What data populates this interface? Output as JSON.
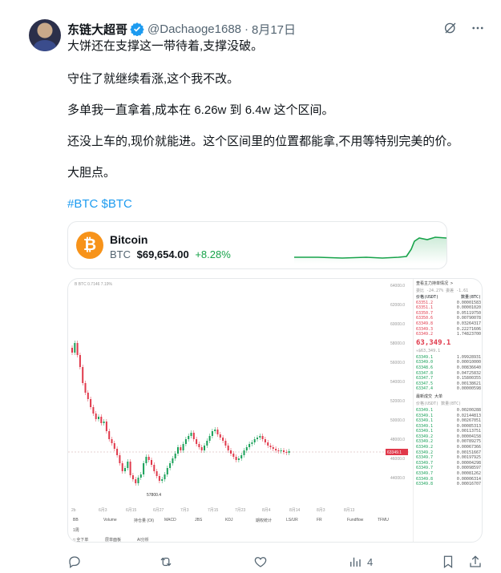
{
  "author": {
    "display_name": "东链大超哥",
    "handle": "@Dachaoge1688",
    "separator": "·",
    "date": "8月17日"
  },
  "body": {
    "p1": "大饼还在支撑这一带待着,支撑没破。",
    "p2": "守住了就继续看涨,这个我不改。",
    "p3": "多单我一直拿着,成本在 6.26w 到 6.4w 这个区间。",
    "p4": "还没上车的,现价就能进。这个区间里的位置都能拿,不用等特别完美的价。",
    "p5": "大胆点。",
    "hashtags": "#BTC $BTC"
  },
  "card": {
    "icon_glyph": "₿",
    "name": "Bitcoin",
    "symbol": "BTC",
    "price": "$69,654.00",
    "change": "+8.28%"
  },
  "chart_image": {
    "ticker_label": "B BTC 0.7146   7.19%",
    "min_label": "57800.4",
    "y_ticks": [
      "64000.0",
      "62000.0",
      "60000.0",
      "58000.0",
      "56000.0",
      "54000.0",
      "52000.0",
      "50000.0",
      "48000.0",
      "46000.0",
      "44000.0"
    ],
    "x_ticks": [
      "2b",
      "6月3",
      "6月15",
      "6月27",
      "7月3",
      "7月15",
      "7月23",
      "8月4",
      "8月14",
      "8月3",
      "8月13"
    ],
    "last_price_tag": "63349.1",
    "tools_row1": [
      "BB",
      "Volume",
      "持仓量 (OI)",
      "MACD",
      "JBS",
      "KDJ",
      "期权统计",
      "LS/UR",
      "FR",
      "Fundflow",
      "TFMU"
    ],
    "tools_row2": [
      "1周"
    ],
    "tools_row3": [
      "□ 全下单",
      "层单面板",
      "AI分析"
    ]
  },
  "orderbook": {
    "title": "查看主力持单情况 >",
    "sub": "委比  -24.27%   委差  -1.61",
    "col_price": "价格(USDT)",
    "col_qty": "数量(BTC)",
    "asks": [
      [
        "63351.2",
        "0.00001583"
      ],
      [
        "63351.1",
        "0.00001020"
      ],
      [
        "63350.7",
        "0.05119750"
      ],
      [
        "63350.6",
        "0.00790078"
      ],
      [
        "63349.8",
        "0.03264317"
      ],
      [
        "63349.3",
        "0.22271606"
      ],
      [
        "63349.2",
        "1.74823700"
      ]
    ],
    "mid_price": "63,349.1",
    "mid_sub": "≈$63,349.1",
    "bids": [
      [
        "63349.1",
        "1.09928931"
      ],
      [
        "63349.0",
        "0.00010000"
      ],
      [
        "63348.6",
        "0.00836640"
      ],
      [
        "63347.8",
        "0.04725832"
      ],
      [
        "63347.7",
        "0.15800355"
      ],
      [
        "63347.5",
        "0.00138621"
      ],
      [
        "63347.4",
        "0.00000598"
      ]
    ],
    "trades_title": "最新成交   大单",
    "trades_cols": "价格(USDT)   数量(BTC)",
    "trades": [
      [
        "63349.1",
        "0.00200288"
      ],
      [
        "63349.1",
        "0.02144813"
      ],
      [
        "63349.1",
        "0.00267051"
      ],
      [
        "63349.1",
        "0.00085313"
      ],
      [
        "63349.1",
        "0.00113751"
      ],
      [
        "63349.2",
        "0.00004158"
      ],
      [
        "63349.2",
        "0.00789275"
      ],
      [
        "63349.2",
        "0.00067366"
      ],
      [
        "63349.2",
        "0.00151667"
      ],
      [
        "63349.7",
        "0.00197925"
      ],
      [
        "63349.7",
        "0.00004298"
      ],
      [
        "63349.7",
        "0.00098597"
      ],
      [
        "63349.7",
        "0.00081262"
      ],
      [
        "63349.8",
        "0.00006314"
      ],
      [
        "63349.8",
        "0.00016707"
      ]
    ]
  },
  "actions": {
    "views": "4"
  },
  "colors": {
    "link": "#1d9bf0",
    "up": "#17a34a",
    "down": "#e0394b",
    "btc": "#f7931a",
    "muted": "#536471"
  }
}
